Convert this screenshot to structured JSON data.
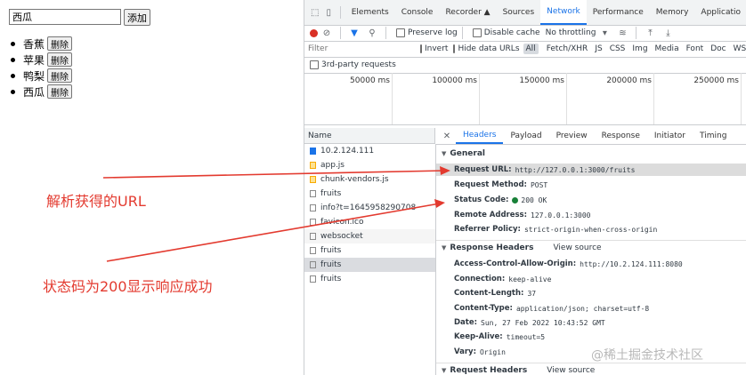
{
  "demo": {
    "input_value": "西瓜",
    "add_label": "添加",
    "delete_label": "删除",
    "fruits": [
      "香蕉",
      "苹果",
      "鸭梨",
      "西瓜"
    ]
  },
  "annotations": {
    "url": "解析获得的URL",
    "status": "状态码为200显示响应成功"
  },
  "devtools": {
    "tabs": [
      "Elements",
      "Console",
      "Recorder ▲",
      "Sources",
      "Network",
      "Performance",
      "Memory",
      "Applicatio"
    ],
    "active_tab": "Network",
    "toolbar": {
      "preserve_log": "Preserve log",
      "disable_cache": "Disable cache",
      "throttling": "No throttling"
    },
    "filter": {
      "placeholder": "Filter",
      "invert": "Invert",
      "hide_data_urls": "Hide data URLs",
      "types": [
        "All",
        "Fetch/XHR",
        "JS",
        "CSS",
        "Img",
        "Media",
        "Font",
        "Doc",
        "WS"
      ]
    },
    "third_party": "3rd-party requests",
    "timeline_ticks": [
      "50000 ms",
      "100000 ms",
      "150000 ms",
      "200000 ms",
      "250000 ms"
    ],
    "name_header": "Name",
    "requests": [
      "10.2.124.111",
      "app.js",
      "chunk-vendors.js",
      "fruits",
      "info?t=1645958290708",
      "favicon.ico",
      "websocket",
      "fruits",
      "fruits",
      "fruits"
    ],
    "detail_tabs": [
      "Headers",
      "Payload",
      "Preview",
      "Response",
      "Initiator",
      "Timing"
    ],
    "general": {
      "title": "General",
      "rows": [
        {
          "k": "Request URL:",
          "v": "http://127.0.0.1:3000/fruits"
        },
        {
          "k": "Request Method:",
          "v": "POST"
        },
        {
          "k": "Status Code:",
          "v": "200 OK"
        },
        {
          "k": "Remote Address:",
          "v": "127.0.0.1:3000"
        },
        {
          "k": "Referrer Policy:",
          "v": "strict-origin-when-cross-origin"
        }
      ]
    },
    "response_headers": {
      "title": "Response Headers",
      "view_source": "View source",
      "rows": [
        {
          "k": "Access-Control-Allow-Origin:",
          "v": "http://10.2.124.111:8080"
        },
        {
          "k": "Connection:",
          "v": "keep-alive"
        },
        {
          "k": "Content-Length:",
          "v": "37"
        },
        {
          "k": "Content-Type:",
          "v": "application/json; charset=utf-8"
        },
        {
          "k": "Date:",
          "v": "Sun, 27 Feb 2022 10:43:52 GMT"
        },
        {
          "k": "Keep-Alive:",
          "v": "timeout=5"
        },
        {
          "k": "Vary:",
          "v": "Origin"
        }
      ]
    },
    "request_headers": {
      "title": "Request Headers",
      "view_source": "View source"
    }
  },
  "watermark": "@稀土掘金技术社区",
  "colors": {
    "accent": "#1a73e8",
    "annotation": "#e33a2f",
    "record": "#d93025",
    "status_ok": "#188038"
  }
}
